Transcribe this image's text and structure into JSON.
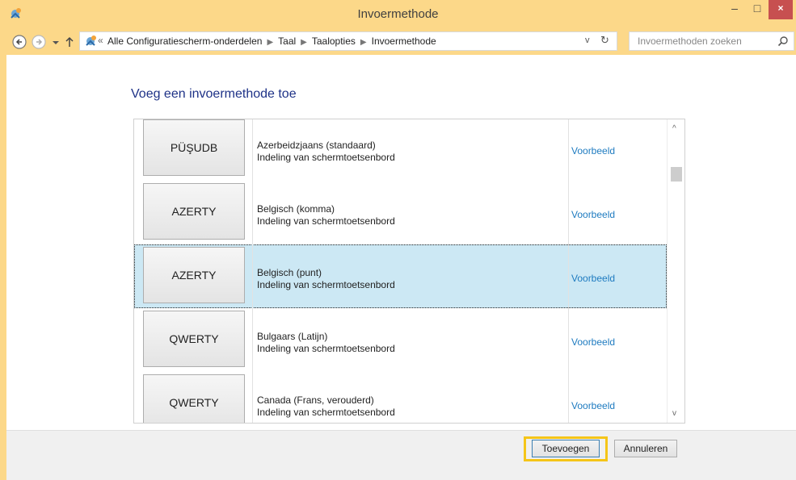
{
  "window": {
    "title": "Invoermethode",
    "minimize_label": "–",
    "maximize_label": "□",
    "close_label": "×"
  },
  "address": {
    "overflow_label": "«",
    "breadcrumbs": [
      "Alle Configuratiescherm-onderdelen",
      "Taal",
      "Taalopties",
      "Invoermethode"
    ],
    "dropdown_label": "v",
    "refresh_label": "↻"
  },
  "search": {
    "placeholder": "Invoermethoden zoeken"
  },
  "main": {
    "heading": "Voeg een invoermethode toe",
    "items": [
      {
        "layout": "PÜŞUDB",
        "name": "Azerbeidzjaans (standaard)",
        "description": "Indeling van schermtoetsenbord",
        "link": "Voorbeeld"
      },
      {
        "layout": "AZERTY",
        "name": "Belgisch (komma)",
        "description": "Indeling van schermtoetsenbord",
        "link": "Voorbeeld"
      },
      {
        "layout": "AZERTY",
        "name": "Belgisch (punt)",
        "description": "Indeling van schermtoetsenbord",
        "link": "Voorbeeld"
      },
      {
        "layout": "QWERTY",
        "name": "Bulgaars (Latijn)",
        "description": "Indeling van schermtoetsenbord",
        "link": "Voorbeeld"
      },
      {
        "layout": "QWERTY",
        "name": "Canada (Frans, verouderd)",
        "description": "Indeling van schermtoetsenbord",
        "link": "Voorbeeld"
      }
    ],
    "selected_index": 2
  },
  "scrollbar": {
    "up_label": "^",
    "down_label": "v"
  },
  "footer": {
    "add_label": "Toevoegen",
    "cancel_label": "Annuleren"
  },
  "colors": {
    "titlebar": "#fcd889",
    "accent_link": "#1e7bc0",
    "heading": "#1e3287",
    "selection": "#cce8f4",
    "highlight": "#f5c518",
    "close_button": "#c75050"
  }
}
